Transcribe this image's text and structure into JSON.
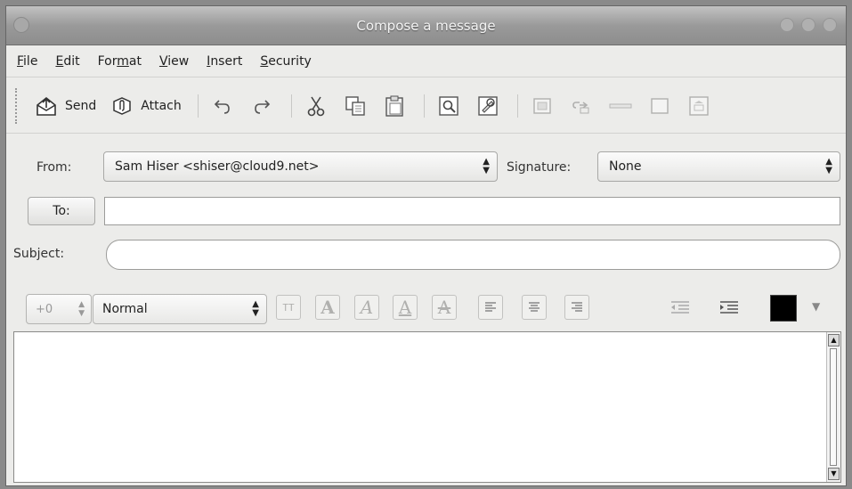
{
  "window": {
    "title": "Compose a message"
  },
  "menubar": [
    {
      "pre": "",
      "mnemonic": "F",
      "post": "ile"
    },
    {
      "pre": "",
      "mnemonic": "E",
      "post": "dit"
    },
    {
      "pre": "For",
      "mnemonic": "m",
      "post": "at"
    },
    {
      "pre": "",
      "mnemonic": "V",
      "post": "iew"
    },
    {
      "pre": "",
      "mnemonic": "I",
      "post": "nsert"
    },
    {
      "pre": "",
      "mnemonic": "S",
      "post": "ecurity"
    }
  ],
  "toolbar": {
    "send_label": "Send",
    "attach_label": "Attach"
  },
  "header": {
    "from_label": "From:",
    "from_value": "Sam Hiser <shiser@cloud9.net>",
    "signature_label": "Signature:",
    "signature_value": "None",
    "to_button": "To:",
    "to_value": "",
    "subject_label": "Subject:",
    "subject_value": ""
  },
  "format_bar": {
    "font_size": "+0",
    "paragraph_style": "Normal",
    "text_color": "#000000"
  },
  "editor": {
    "body": ""
  }
}
